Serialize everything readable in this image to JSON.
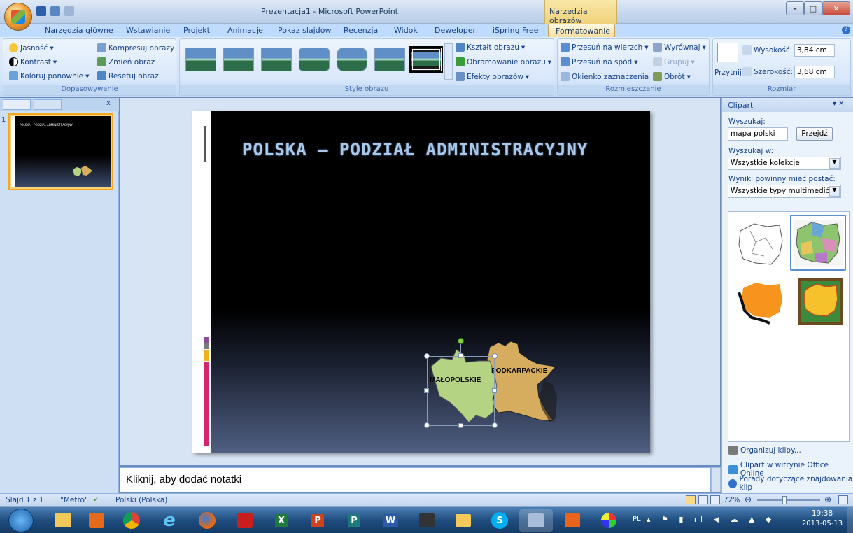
{
  "window": {
    "title": "Prezentacja1 - Microsoft PowerPoint",
    "context_title": "Narzędzia obrazów"
  },
  "tabs": [
    "Narzędzia główne",
    "Wstawianie",
    "Projekt",
    "Animacje",
    "Pokaz slajdów",
    "Recenzja",
    "Widok",
    "Deweloper",
    "iSpring Free",
    "Formatowanie"
  ],
  "ribbon": {
    "adjust": {
      "label": "Dopasowywanie",
      "brightness": "Jasność",
      "contrast": "Kontrast",
      "recolor": "Koloruj ponownie",
      "compress": "Kompresuj obrazy",
      "change": "Zmień obraz",
      "reset": "Resetuj obraz"
    },
    "styles": {
      "label": "Style obrazu",
      "shape": "Kształt obrazu",
      "border": "Obramowanie obrazu",
      "effects": "Efekty obrazów"
    },
    "arrange": {
      "label": "Rozmieszczanie",
      "front": "Przesuń na wierzch",
      "back": "Przesuń na spód",
      "selection": "Okienko zaznaczenia",
      "align": "Wyrównaj",
      "group": "Grupuj",
      "rotate": "Obrót"
    },
    "size": {
      "label": "Rozmiar",
      "crop": "Przytnij",
      "height_label": "Wysokość:",
      "height": "3,84 cm",
      "width_label": "Szerokość:",
      "width": "3,68 cm"
    }
  },
  "slide": {
    "number": "1",
    "title": "POLSKA – PODZIAŁ ADMINISTRACYJNY",
    "thumb_title": "POLSKA – PODZIAŁ ADMINISTRACYJNY",
    "region1": "MAŁOPOLSKIE",
    "region2": "PODKARPACKIE"
  },
  "notes": {
    "placeholder": "Kliknij, aby dodać notatki"
  },
  "clipart": {
    "title": "Clipart",
    "search_label": "Wyszukaj:",
    "search_value": "mapa polski",
    "go": "Przejdź",
    "search_in_label": "Wyszukaj w:",
    "search_in": "Wszystkie kolekcje",
    "result_type_label": "Wyniki powinny mieć postać:",
    "result_type": "Wszystkie typy multimediów",
    "links": [
      "Organizuj klipy...",
      "Clipart w witrynie Office Online",
      "Porady dotyczące znajdowania klip"
    ]
  },
  "status": {
    "slide": "Slajd 1 z 1",
    "theme": "\"Metro\"",
    "language": "Polski (Polska)",
    "zoom": "72%"
  },
  "taskbar": {
    "lang": "PL",
    "time": "19:38",
    "date": "2013-05-13"
  }
}
